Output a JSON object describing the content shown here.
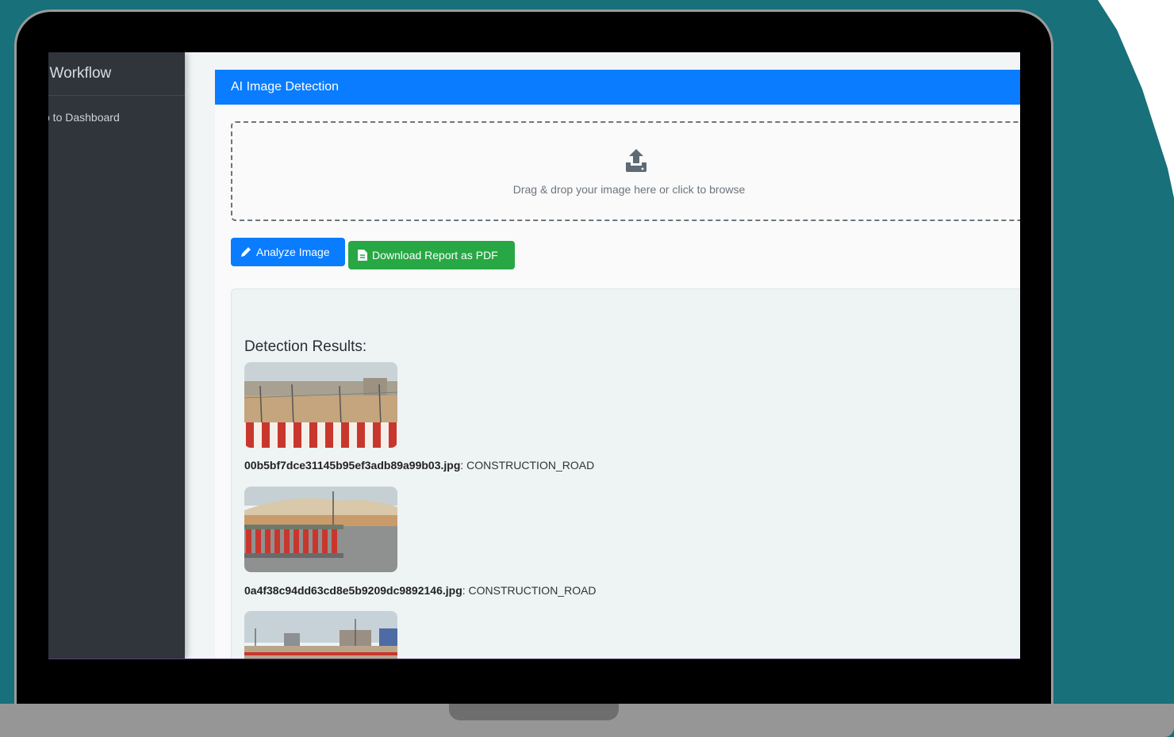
{
  "sidebar": {
    "title": "l Workflow",
    "dashboard_link": "o to Dashboard"
  },
  "card": {
    "header": "AI Image Detection"
  },
  "dropzone": {
    "icon": "upload-icon",
    "text": "Drag & drop your image here or click to browse"
  },
  "buttons": {
    "analyze": {
      "label": "Analyze Image",
      "icon": "pencil-icon"
    },
    "download": {
      "label": "Download Report as PDF",
      "icon": "file-pdf-icon"
    }
  },
  "results": {
    "title": "Detection Results:",
    "items": [
      {
        "filename": "00b5bf7dce31145b95ef3adb89a99b03.jpg",
        "separator": ":",
        "label": "CONSTRUCTION_ROAD"
      },
      {
        "filename": "0a4f38c94dd63cd8e5b9209dc9892146.jpg",
        "separator": ":",
        "label": "CONSTRUCTION_ROAD"
      }
    ]
  },
  "colors": {
    "primary": "#0a7cff",
    "success": "#28a745",
    "sidebar": "#2f353a",
    "background": "#17707a"
  }
}
